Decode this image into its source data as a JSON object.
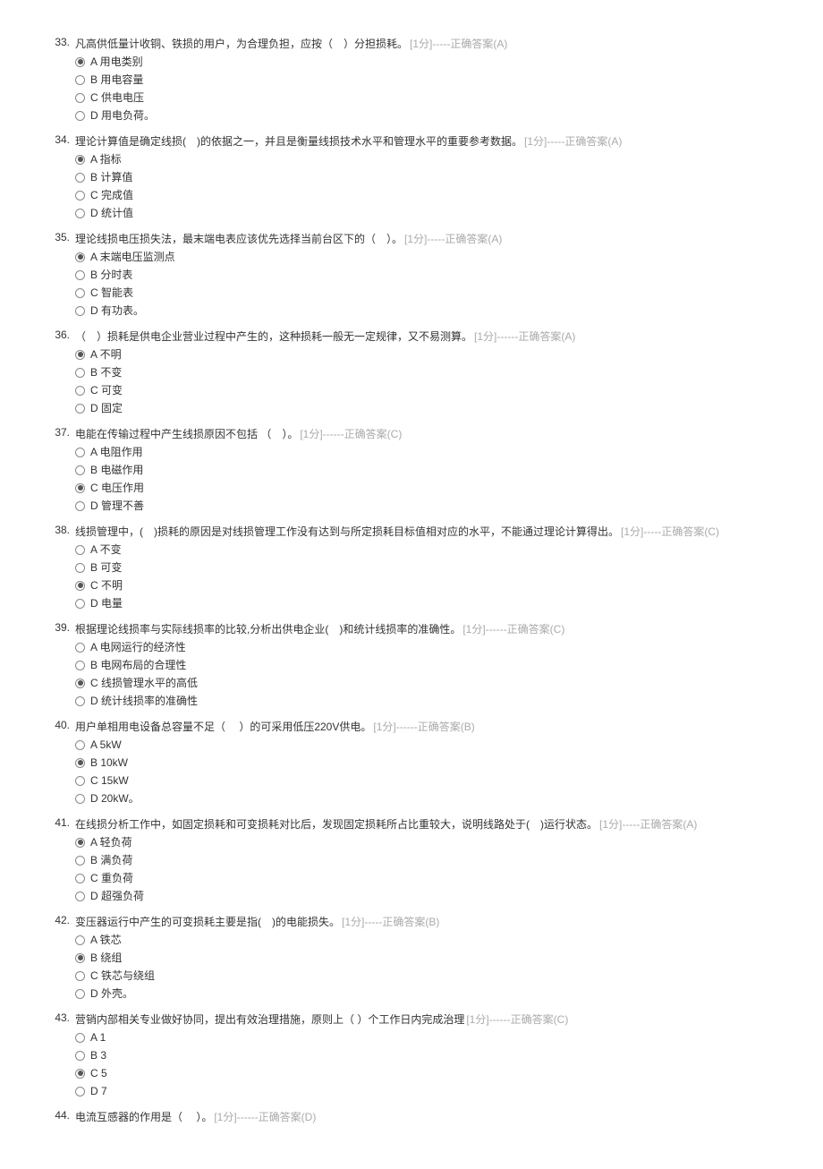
{
  "questions": [
    {
      "num": "33.",
      "text": "凡高供低量计收铜、铁损的用户，为合理负担，应按（　）分担损耗。",
      "meta": "[1分]-----正确答案(A)",
      "meta_inline": true,
      "options": [
        {
          "label": "A 用电类别",
          "checked": true
        },
        {
          "label": "B 用电容量",
          "checked": false
        },
        {
          "label": "C 供电电压",
          "checked": false
        },
        {
          "label": "D 用电负荷。",
          "checked": false
        }
      ]
    },
    {
      "num": "34.",
      "text": "理论计算值是确定线损(　)的依据之一，并且是衡量线损技术水平和管理水平的重要参考数据。",
      "meta": "[1分]-----正确答案(A)",
      "meta_inline": false,
      "options": [
        {
          "label": "A 指标",
          "checked": true
        },
        {
          "label": "B 计算值",
          "checked": false
        },
        {
          "label": "C 完成值",
          "checked": false
        },
        {
          "label": "D 统计值",
          "checked": false
        }
      ]
    },
    {
      "num": "35.",
      "text": "理论线损电压损失法，最末端电表应该优先选择当前台区下的（　）。",
      "meta": "[1分]-----正确答案(A)",
      "meta_inline": true,
      "options": [
        {
          "label": "A 末端电压监测点",
          "checked": true
        },
        {
          "label": "B 分时表",
          "checked": false
        },
        {
          "label": "C 智能表",
          "checked": false
        },
        {
          "label": "D 有功表。",
          "checked": false
        }
      ]
    },
    {
      "num": "36.",
      "text": "（　）损耗是供电企业营业过程中产生的，这种损耗一般无一定规律，又不易测算。",
      "meta": "[1分]------正确答案(A)",
      "meta_inline": true,
      "options": [
        {
          "label": "A 不明",
          "checked": true
        },
        {
          "label": "B 不变",
          "checked": false
        },
        {
          "label": "C 可变",
          "checked": false
        },
        {
          "label": "D 固定",
          "checked": false
        }
      ]
    },
    {
      "num": "37.",
      "text": "电能在传输过程中产生线损原因不包括 （　）。",
      "meta": "[1分]------正确答案(C)",
      "meta_inline": true,
      "options": [
        {
          "label": "A 电阻作用",
          "checked": false
        },
        {
          "label": "B 电磁作用",
          "checked": false
        },
        {
          "label": "C 电压作用",
          "checked": true
        },
        {
          "label": "D 管理不善",
          "checked": false
        }
      ]
    },
    {
      "num": "38.",
      "text": "线损管理中，(　)损耗的原因是对线损管理工作没有达到与所定损耗目标值相对应的水平，不能通过理论计算得出。",
      "meta": "[1分]-----正确答案(C)",
      "meta_inline": true,
      "options": [
        {
          "label": "A 不变",
          "checked": false
        },
        {
          "label": "B 可变",
          "checked": false
        },
        {
          "label": "C 不明",
          "checked": true
        },
        {
          "label": "D 电量",
          "checked": false
        }
      ]
    },
    {
      "num": "39.",
      "text": "根据理论线损率与实际线损率的比较,分析出供电企业(　)和统计线损率的准确性。",
      "meta": "[1分]------正确答案(C)",
      "meta_inline": true,
      "options": [
        {
          "label": "A 电网运行的经济性",
          "checked": false
        },
        {
          "label": "B 电网布局的合理性",
          "checked": false
        },
        {
          "label": "C 线损管理水平的高低",
          "checked": true
        },
        {
          "label": "D 统计线损率的准确性",
          "checked": false
        }
      ]
    },
    {
      "num": "40.",
      "text": "用户单相用电设备总容量不足（　 ）的可采用低压220V供电。",
      "meta": "[1分]------正确答案(B)",
      "meta_inline": true,
      "options": [
        {
          "label": "A 5kW",
          "checked": false
        },
        {
          "label": "B 10kW",
          "checked": true
        },
        {
          "label": "C 15kW",
          "checked": false
        },
        {
          "label": "D 20kW。",
          "checked": false
        }
      ]
    },
    {
      "num": "41.",
      "text": "在线损分析工作中，如固定损耗和可变损耗对比后，发现固定损耗所占比重较大，说明线路处于(　)运行状态。",
      "meta": "[1分]-----正确答案(A)",
      "meta_inline": false,
      "options": [
        {
          "label": "A 轻负荷",
          "checked": true
        },
        {
          "label": "B 满负荷",
          "checked": false
        },
        {
          "label": "C 重负荷",
          "checked": false
        },
        {
          "label": "D 超强负荷",
          "checked": false
        }
      ]
    },
    {
      "num": "42.",
      "text": "变压器运行中产生的可变损耗主要是指(　)的电能损失。",
      "meta": "[1分]-----正确答案(B)",
      "meta_inline": true,
      "options": [
        {
          "label": "A 铁芯",
          "checked": false
        },
        {
          "label": "B 绕组",
          "checked": true
        },
        {
          "label": "C 铁芯与绕组",
          "checked": false
        },
        {
          "label": "D 外壳。",
          "checked": false
        }
      ]
    },
    {
      "num": "43.",
      "text": "营销内部相关专业做好协同，提出有效治理措施，原则上（ ）个工作日内完成治理",
      "meta": "[1分]------正确答案(C)",
      "meta_inline": true,
      "options": [
        {
          "label": "A 1",
          "checked": false
        },
        {
          "label": "B 3",
          "checked": false
        },
        {
          "label": "C 5",
          "checked": true
        },
        {
          "label": "D 7",
          "checked": false
        }
      ]
    },
    {
      "num": "44.",
      "text": "电流互感器的作用是（　 ）。",
      "meta": "[1分]------正确答案(D)",
      "meta_inline": true,
      "options": []
    }
  ]
}
